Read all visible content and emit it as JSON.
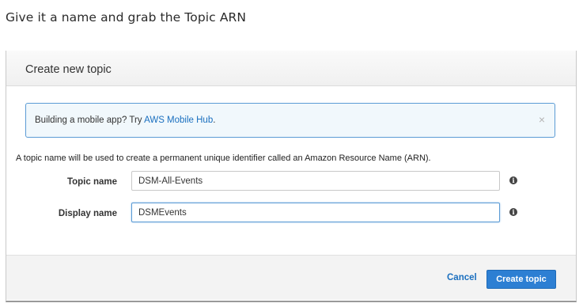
{
  "caption": "Give it a name and grab the Topic ARN",
  "dialog": {
    "title": "Create new topic",
    "info_banner": {
      "text": "Building a mobile app? Try ",
      "link_text": "AWS Mobile Hub",
      "trailing": ".",
      "close_glyph": "×"
    },
    "description": "A topic name will be used to create a permanent unique identifier called an Amazon Resource Name (ARN).",
    "fields": {
      "topic_name": {
        "label": "Topic name",
        "value": "DSM-All-Events",
        "help_icon": "info-icon"
      },
      "display_name": {
        "label": "Display name",
        "value": "DSMEvents",
        "help_icon": "info-icon"
      }
    },
    "footer": {
      "cancel_label": "Cancel",
      "create_label": "Create topic"
    }
  },
  "colors": {
    "accent": "#2d7fd3",
    "link": "#1a6fbf",
    "info_border": "#5b9bd5",
    "info_bg": "#f1f8fc"
  }
}
